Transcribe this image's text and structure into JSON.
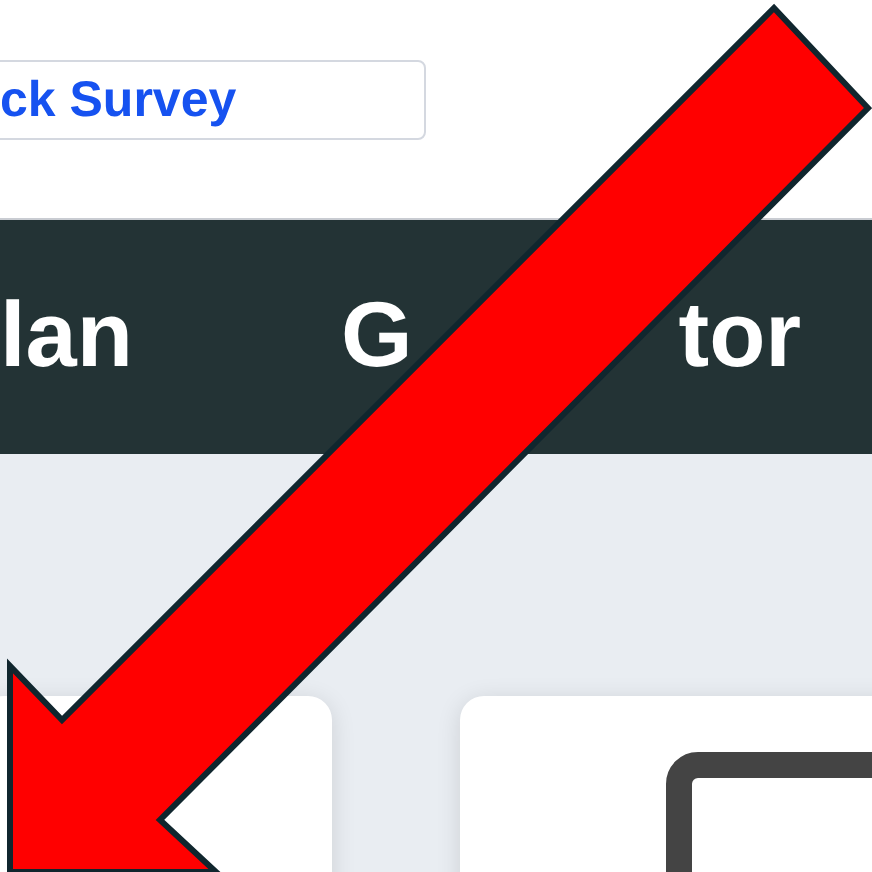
{
  "survey_field": {
    "value": "ck Survey"
  },
  "nav": {
    "items": [
      {
        "parts": [
          "lan"
        ]
      },
      {
        "parts": [
          "G",
          "tor"
        ]
      }
    ]
  },
  "cards": [
    {
      "kind": "plain"
    },
    {
      "kind": "icon"
    }
  ]
}
